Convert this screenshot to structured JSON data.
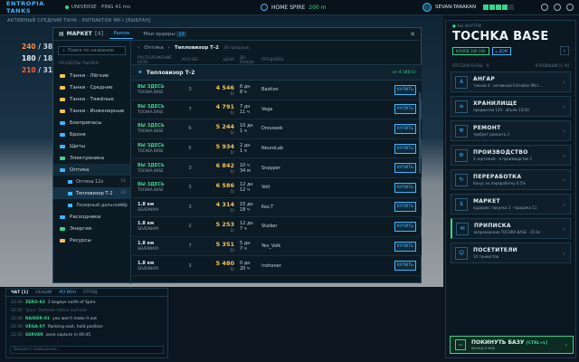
{
  "topbar": {
    "logo": "ENTROPIA TANKS",
    "universe": "UNIVERSE · PING 41 ms",
    "location_label": "HOME SPIRE",
    "location_value": "200 m",
    "user": "SEVAN-TARAKAN",
    "signal_bars": 5,
    "signal_active": 4
  },
  "scene": {
    "subtitle": "АКТИВНЫЙ СРЕДНИЙ ТАНК · ENTRAKTOR MK-I [ВЫБРАН]",
    "stats": [
      {
        "value": "240",
        "max": "/ 380 +5"
      },
      {
        "value": "180",
        "max": "/ 183"
      },
      {
        "value": "210",
        "max": "/ 31"
      }
    ]
  },
  "market": {
    "title": "МАРКЕТ",
    "title_count": "[4]",
    "tab_market": "Рынок",
    "tab_orders": "Мои ордеры",
    "orders_count": "12",
    "search_placeholder": "Поиск по названию",
    "sections_header": "РАЗДЕЛЫ РЫНКА",
    "categories": [
      {
        "label": "Танки · Лёгкие",
        "count": "",
        "color": "#f0c35a"
      },
      {
        "label": "Танки · Средние",
        "count": "",
        "color": "#f0c35a"
      },
      {
        "label": "Танки · Тяжёлые",
        "count": "",
        "color": "#f0c35a"
      },
      {
        "label": "Танки · Инженерные",
        "count": "",
        "color": "#f0c35a"
      },
      {
        "label": "Боеприпасы",
        "count": "",
        "color": "#3fb6ff"
      },
      {
        "label": "Броня",
        "count": "",
        "color": "#3fb6ff"
      },
      {
        "label": "Щиты",
        "count": "",
        "color": "#3fb6ff"
      },
      {
        "label": "Электроника",
        "count": "",
        "color": "#36d68a"
      },
      {
        "label": "Оптика",
        "count": "",
        "color": "#3fb6ff"
      }
    ],
    "optics_sub": [
      {
        "label": "Оптика 12x",
        "count": "18"
      },
      {
        "label": "Тепловизор Т-2",
        "count": "30"
      },
      {
        "label": "Лазерный дальномер",
        "count": "19"
      }
    ],
    "categories_after": [
      {
        "label": "Расходники",
        "color": "#3fb6ff"
      },
      {
        "label": "Энергия",
        "color": "#36d68a"
      },
      {
        "label": "Ресурсы",
        "color": "#f0c35a"
      }
    ],
    "breadcrumb_root": "Оптика",
    "breadcrumb_current": "Тепловизор Т-2",
    "breadcrumb_note": "30 предлож.",
    "columns": [
      "РАСПОЛОЖЕНИЕ · БАЗА",
      "КОЛ-ВО",
      "ЦЕНА",
      "ДО КОНЦА",
      "ПРОДАВЕЦ"
    ],
    "item_name": "Тепловизор Т-2",
    "item_meta": "от 4 346 Cr",
    "buy_label": "КУПИТЬ",
    "listings": [
      {
        "loc": "ВЫ ЗДЕСЬ",
        "base": "TOCHKA BASE",
        "qty": "3",
        "price": "4 546",
        "dur1": "6 дн",
        "dur2": "8 ч",
        "seller": "Bastion",
        "here": true
      },
      {
        "loc": "ВЫ ЗДЕСЬ",
        "base": "TOCHKA BASE",
        "qty": "7",
        "price": "4 791",
        "dur1": "7 дн",
        "dur2": "11 ч",
        "seller": "Vega",
        "here": true
      },
      {
        "loc": "ВЫ ЗДЕСЬ",
        "base": "TOCHKA BASE",
        "qty": "6",
        "price": "5 244",
        "dur1": "10 дн",
        "dur2": "1 ч",
        "seller": "Drovosek",
        "here": true
      },
      {
        "loc": "ВЫ ЗДЕСЬ",
        "base": "TOCHKA BASE",
        "qty": "5",
        "price": "5 934",
        "dur1": "2 дн",
        "dur2": "1 ч",
        "seller": "NeuroLab",
        "here": true
      },
      {
        "loc": "ВЫ ЗДЕСЬ",
        "base": "TOCHKA BASE",
        "qty": "3",
        "price": "6 842",
        "dur1": "10 ч",
        "dur2": "34 м",
        "seller": "Snayper",
        "here": true
      },
      {
        "loc": "ВЫ ЗДЕСЬ",
        "base": "TOCHKA BASE",
        "qty": "3",
        "price": "6 586",
        "dur1": "12 дн",
        "dur2": "12 ч",
        "seller": "Volt",
        "here": true
      },
      {
        "loc": "1.8 км",
        "base": "SEVERNAYA",
        "qty": "3",
        "price": "4 314",
        "dur1": "15 дн",
        "dur2": "18 ч",
        "seller": "Kos.T",
        "here": false
      },
      {
        "loc": "1.8 км",
        "base": "SEVERNAYA",
        "qty": "2",
        "price": "5 253",
        "dur1": "12 дн",
        "dur2": "7 ч",
        "seller": "Stalker",
        "here": false
      },
      {
        "loc": "1.8 км",
        "base": "SEVERNAYA",
        "qty": "7",
        "price": "5 351",
        "dur1": "5 дн",
        "dur2": "7 ч",
        "seller": "Yev_Volk",
        "here": false
      },
      {
        "loc": "1.8 км",
        "base": "SEVERNAYA",
        "qty": "3",
        "price": "5 480",
        "dur1": "0 дн",
        "dur2": "20 ч",
        "seller": "Inzhener",
        "here": false
      }
    ],
    "currency": "Cr"
  },
  "chat": {
    "title": "ЧАТ",
    "count": "[1]",
    "tabs": [
      "ОБЩИЙ",
      "РЕГИОН",
      "ОТРЯД"
    ],
    "active_tab": "РЕГИОН",
    "messages": [
      {
        "time": "22:46",
        "who": "ZERO-83",
        "text": "2 bogeys north of Spire",
        "sys": false
      },
      {
        "time": "22:47",
        "who": "",
        "text": "Spire: Defense status nominal",
        "sys": true
      },
      {
        "time": "22:48",
        "who": "RAIDER-01",
        "text": "you won't make it out",
        "sys": false
      },
      {
        "time": "22:49",
        "who": "VEGA-07",
        "text": "flanking east, hold position",
        "sys": false
      },
      {
        "time": "22:50",
        "who": "SERVER",
        "text": "zone capture in 00:45",
        "sys": false
      }
    ],
    "input_placeholder": "Введите сообщение..."
  },
  "rpanel": {
    "top_label": "ВЫ ВНУТРИ",
    "base_name": "TOCHKA BASE",
    "tag_coords": "КООРД 100:160",
    "tag_status": "ДОМ",
    "list_header_left": "ОТСЕКИ БАЗЫ · 9",
    "list_header_right": "КЛАВИШИ [1–9]",
    "modules": [
      {
        "icon": "A",
        "name": "АНГАР",
        "desc": "танков 4 · активный Entraktor Mk-I ..."
      },
      {
        "icon": "≡",
        "name": "ХРАНИЛИЩЕ",
        "desc": "предметов 129 · объём 15/30"
      },
      {
        "icon": "⚒",
        "name": "РЕМОНТ",
        "desc": "требует ремонта 3"
      },
      {
        "icon": "⚙",
        "name": "ПРОИЗВОДСТВО",
        "desc": "3 чертежей · в производстве 1"
      },
      {
        "icon": "↻",
        "name": "ПЕРЕРАБОТКА",
        "desc": "бонус на переработку 6.5%"
      },
      {
        "icon": "$",
        "name": "МАРКЕТ",
        "desc": "ордеров: покупка 3 · продажа 11"
      },
      {
        "icon": "✉",
        "name": "ПРИПИСКА",
        "desc": "возрождение TOCHKA BASE · 15.0s"
      },
      {
        "icon": "☺",
        "name": "ПОСЕТИТЕЛИ",
        "desc": "14 танкистов"
      }
    ],
    "leave_title": "ПОКИНУТЬ БАЗУ",
    "leave_key": "[CTRL+L]",
    "leave_desc": "выход в мир"
  }
}
